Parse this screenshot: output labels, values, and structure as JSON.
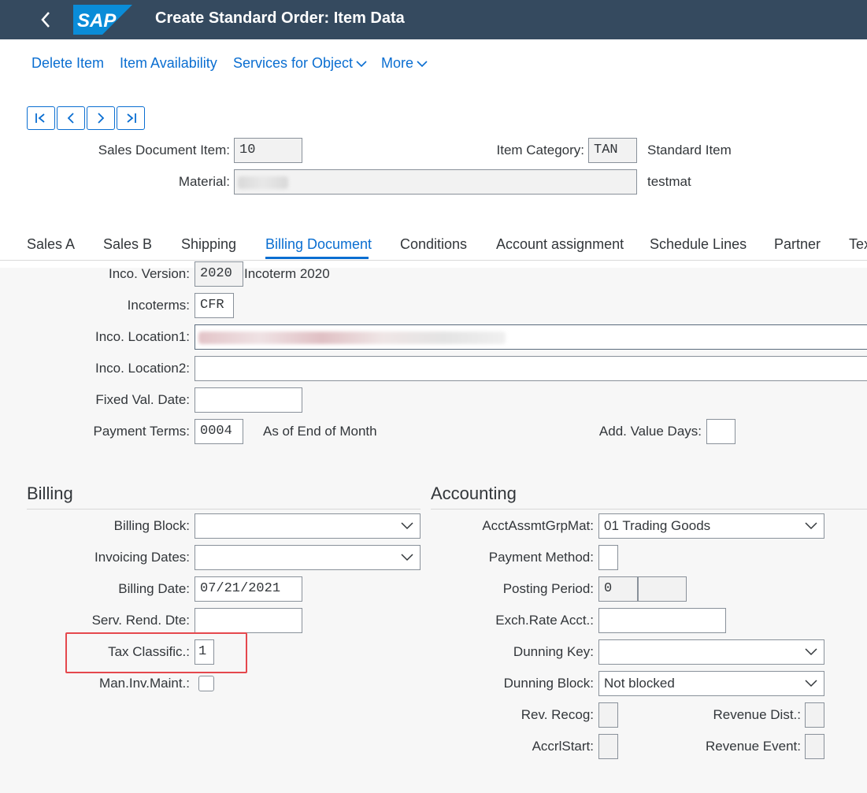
{
  "header": {
    "title": "Create Standard Order: Item Data",
    "logo_text": "SAP",
    "brand_color": "#354a5f",
    "logo_color": "#0a8cd8"
  },
  "toolbar": {
    "delete_item": "Delete Item",
    "item_availability": "Item Availability",
    "services_for_object": "Services for Object",
    "more": "More"
  },
  "nav_icons": [
    "first-page-icon",
    "previous-icon",
    "next-icon",
    "last-page-icon"
  ],
  "item": {
    "sales_doc_item_label": "Sales Document Item:",
    "sales_doc_item_value": "10",
    "item_category_label": "Item Category:",
    "item_category_value": "TAN",
    "item_category_text": "Standard Item",
    "material_label": "Material:",
    "material_value": "",
    "material_text": "testmat"
  },
  "tabs": [
    "Sales A",
    "Sales B",
    "Shipping",
    "Billing Document",
    "Conditions",
    "Account assignment",
    "Schedule Lines",
    "Partner",
    "Texts"
  ],
  "active_tab": "Billing Document",
  "incoterms": {
    "inco_version_label": "Inco. Version:",
    "inco_version_value": "2020",
    "inco_version_text": "Incoterm 2020",
    "incoterms_label": "Incoterms:",
    "incoterms_value": "CFR",
    "inco_location1_label": "Inco. Location1:",
    "inco_location1_value": "",
    "inco_location2_label": "Inco. Location2:",
    "inco_location2_value": "",
    "fixed_val_date_label": "Fixed Val. Date:",
    "fixed_val_date_value": "",
    "payment_terms_label": "Payment Terms:",
    "payment_terms_value": "0004",
    "payment_terms_text": "As of End of Month",
    "add_value_days_label": "Add. Value Days:",
    "add_value_days_value": ""
  },
  "billing": {
    "title": "Billing",
    "billing_block_label": "Billing Block:",
    "billing_block_value": "",
    "invoicing_dates_label": "Invoicing Dates:",
    "invoicing_dates_value": "",
    "billing_date_label": "Billing Date:",
    "billing_date_value": "07/21/2021",
    "serv_rend_dte_label": "Serv. Rend. Dte:",
    "serv_rend_dte_value": "",
    "tax_classific_label": "Tax Classific.:",
    "tax_classific_value": "1",
    "man_inv_maint_label": "Man.Inv.Maint.:"
  },
  "accounting": {
    "title": "Accounting",
    "acct_assmt_label": "AcctAssmtGrpMat:",
    "acct_assmt_value": "01 Trading Goods",
    "payment_method_label": "Payment Method:",
    "payment_method_value": "",
    "posting_period_label": "Posting Period:",
    "posting_period_value": "0",
    "posting_period_value2": "",
    "exch_rate_label": "Exch.Rate Acct.:",
    "exch_rate_value": "",
    "dunning_key_label": "Dunning Key:",
    "dunning_key_value": "",
    "dunning_block_label": "Dunning Block:",
    "dunning_block_value": "Not blocked",
    "rev_recog_label": "Rev. Recog:",
    "rev_recog_value": "",
    "revenue_dist_label": "Revenue Dist.:",
    "revenue_dist_value": "",
    "accrl_start_label": "AccrlStart:",
    "accrl_start_value": "",
    "revenue_event_label": "Revenue Event:",
    "revenue_event_value": ""
  },
  "annotation": {
    "highlight_color": "#e5484d"
  }
}
